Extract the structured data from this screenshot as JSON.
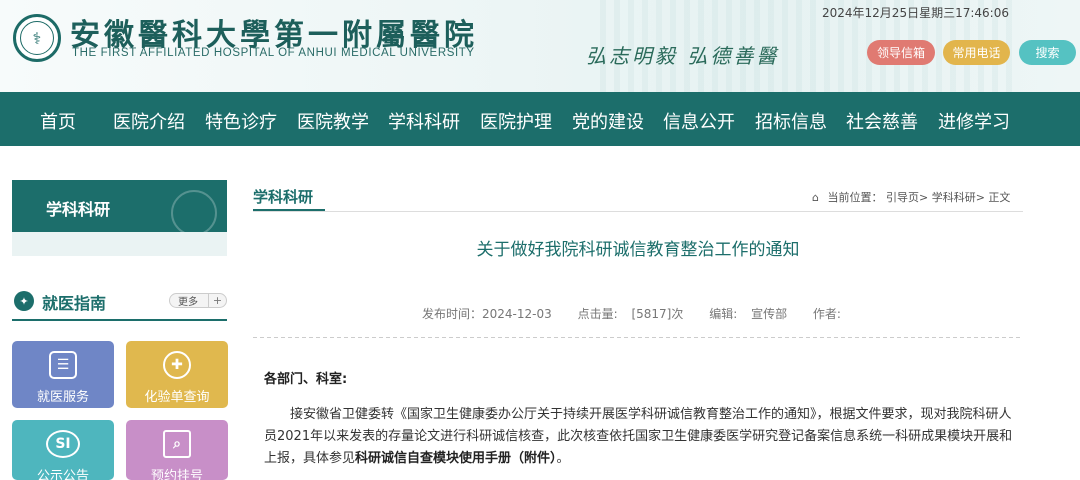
{
  "header": {
    "logo_cn": "安徽醫科大學第一附屬醫院",
    "logo_en": "THE FIRST AFFILIATED HOSPITAL OF ANHUI MEDICAL UNIVERSITY",
    "datetime": "2024年12月25日星期三17:46:06",
    "motto": "弘志明毅 弘德善醫",
    "buttons": [
      "领导信箱",
      "常用电话",
      "搜索"
    ],
    "button_colors": [
      "#e07a72",
      "#e2b54c",
      "#55c2c2"
    ]
  },
  "nav": {
    "items": [
      "首页",
      "医院介绍",
      "特色诊疗",
      "医院教学",
      "学科科研",
      "医院护理",
      "党的建设",
      "信息公开",
      "招标信息",
      "社会慈善",
      "进修学习"
    ],
    "bg_color": "#1c6e6b"
  },
  "sidebar": {
    "section_title": "学科科研",
    "guide_title": "就医指南",
    "more_label": "更多",
    "tiles": [
      {
        "label": "就医服务",
        "icon": "clipboard-icon"
      },
      {
        "label": "化验单查询",
        "icon": "medical-cross-icon"
      },
      {
        "label": "公示公告",
        "icon": "si-badge-icon"
      },
      {
        "label": "预约挂号",
        "icon": "search-document-icon"
      }
    ]
  },
  "main": {
    "section_title": "学科科研",
    "location_label": "当前位置：",
    "breadcrumb": "引导页> 学科科研> 正文",
    "article_title": "关于做好我院科研诚信教育整治工作的通知",
    "meta": {
      "publish": "发布时间：2024-12-03",
      "clicks_label": "点击量:",
      "clicks_value": "[5817]次",
      "editor": "编辑:",
      "department": "宣传部",
      "author": "作者:"
    },
    "greeting": "各部门、科室:",
    "paragraph_pre": "接安徽省卫健委转《国家卫生健康委办公厅关于持续开展医学科研诚信教育整治工作的通知》，根据文件要求，现对我院科研人员2021年以来发表的存量论文进行科研诚信核查，此次核查依托国家卫生健康委医学研究登记备案信息系统一科研成果模块开展和上报，具体参见",
    "paragraph_bold": "科研诚信自查模块使用手册（附件）",
    "paragraph_post": "。"
  }
}
